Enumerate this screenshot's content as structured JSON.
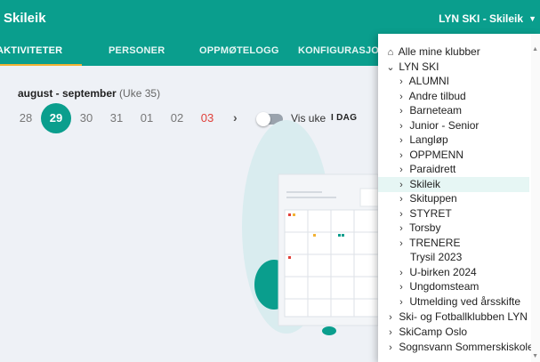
{
  "app": {
    "title": "Skileik",
    "club_label": "LYN SKI - Skileik"
  },
  "tabs": [
    {
      "label": "AKTIVITETER"
    },
    {
      "label": "PERSONER"
    },
    {
      "label": "OPPMØTELOGG"
    },
    {
      "label": "KONFIGURASJON"
    }
  ],
  "calendar": {
    "period": "august - september",
    "week": "(Uke 35)",
    "days": [
      "28",
      "29",
      "30",
      "31",
      "01",
      "02",
      "03"
    ],
    "selected_day": "29",
    "sunday_day": "03",
    "next_label": "›",
    "toggle_label": "Vis uke",
    "today_label": "I DAG"
  },
  "dropdown": {
    "items": [
      {
        "label": "Alle mine klubber",
        "icon": "home-icon"
      },
      {
        "label": "LYN SKI",
        "icon": "chevron-down-icon"
      },
      {
        "label": "ALUMNI",
        "icon": "chevron-right-icon"
      },
      {
        "label": "Andre tilbud",
        "icon": "chevron-right-icon"
      },
      {
        "label": "Barneteam",
        "icon": "chevron-right-icon"
      },
      {
        "label": "Junior - Senior",
        "icon": "chevron-right-icon"
      },
      {
        "label": "Langløp",
        "icon": "chevron-right-icon"
      },
      {
        "label": "OPPMENN",
        "icon": "chevron-right-icon"
      },
      {
        "label": "Paraidrett",
        "icon": "chevron-right-icon"
      },
      {
        "label": "Skileik",
        "icon": "chevron-right-icon"
      },
      {
        "label": "Skituppen",
        "icon": "chevron-right-icon"
      },
      {
        "label": "STYRET",
        "icon": "chevron-right-icon"
      },
      {
        "label": "Torsby",
        "icon": "chevron-right-icon"
      },
      {
        "label": "TRENERE",
        "icon": "chevron-right-icon"
      },
      {
        "label": "Trysil 2023",
        "icon": ""
      },
      {
        "label": "U-birken 2024",
        "icon": "chevron-right-icon"
      },
      {
        "label": "Ungdomsteam",
        "icon": "chevron-right-icon"
      },
      {
        "label": "Utmelding ved årsskifte",
        "icon": "chevron-right-icon"
      },
      {
        "label": "Ski- og Fotballklubben LYN",
        "icon": "chevron-right-icon"
      },
      {
        "label": "SkiCamp Oslo",
        "icon": "chevron-right-icon"
      },
      {
        "label": "Sognsvann Sommerskiskole",
        "icon": "chevron-right-icon"
      }
    ],
    "highlighted": "Skileik"
  },
  "colors": {
    "primary": "#0a9e8d",
    "accent": "#f2b234",
    "sunday": "#e0403a",
    "highlight": "#e6f6f4"
  }
}
